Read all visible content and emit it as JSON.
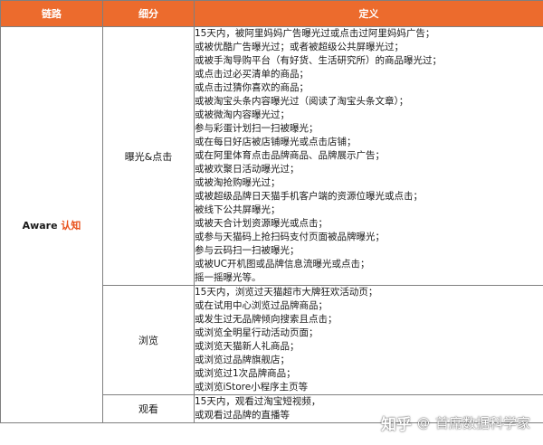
{
  "header": {
    "chain": "链路",
    "sub": "细分",
    "def": "定义"
  },
  "chain_label": {
    "latin": "Aware",
    "cjk": "认知"
  },
  "rows": [
    {
      "sub": "曝光&点击",
      "lines": [
        "15天内，被阿里妈妈广告曝光过或点击过阿里妈妈广告；",
        "或被优酷广告曝光过；或者被超级公共屏曝光过；",
        "或被手淘导购平台（有好货、生活研究所）的商品曝光过；",
        "或点击过必买清单的商品；",
        "或点击过猜你喜欢的商品；",
        "或被淘宝头条内容曝光过（阅读了淘宝头条文章）；",
        "或被微淘内容曝光过；",
        "参与彩蛋计划扫一扫被曝光；",
        "或在每日好店被店铺曝光或点击店铺；",
        "或在阿里体育点击品牌商品、品牌展示广告；",
        "或被欢聚日活动曝光过；",
        "或被淘抢购曝光过；",
        "或被超级品牌日天猫手机客户端的资源位曝光或点击；",
        "被线下公共屏曝光；",
        "或被天合计划资源曝光或点击；",
        "或参与天猫码上抢扫码支付页面被品牌曝光；",
        "参与云码扫一扫被曝光；",
        "或被UC开机图或品牌信息流曝光或点击；",
        "摇一摇曝光等。"
      ]
    },
    {
      "sub": "浏览",
      "lines": [
        "15天内，浏览过天猫超市大牌狂欢活动页；",
        "或在试用中心浏览过品牌商品；",
        "或发生过无品牌倾向搜索且点击；",
        "或浏览全明星行动活动页面；",
        "或浏览天猫新人礼商品；",
        "或浏览过品牌旗舰店；",
        "或浏览过1次品牌商品；",
        "或浏览iStore小程序主页等"
      ]
    },
    {
      "sub": "观看",
      "lines": [
        "15天内，观看过淘宝短视频，",
        "或观看过品牌的直播等"
      ]
    }
  ],
  "watermark": {
    "brand": "知乎",
    "sep": "@",
    "author": "首席数据科学家"
  }
}
